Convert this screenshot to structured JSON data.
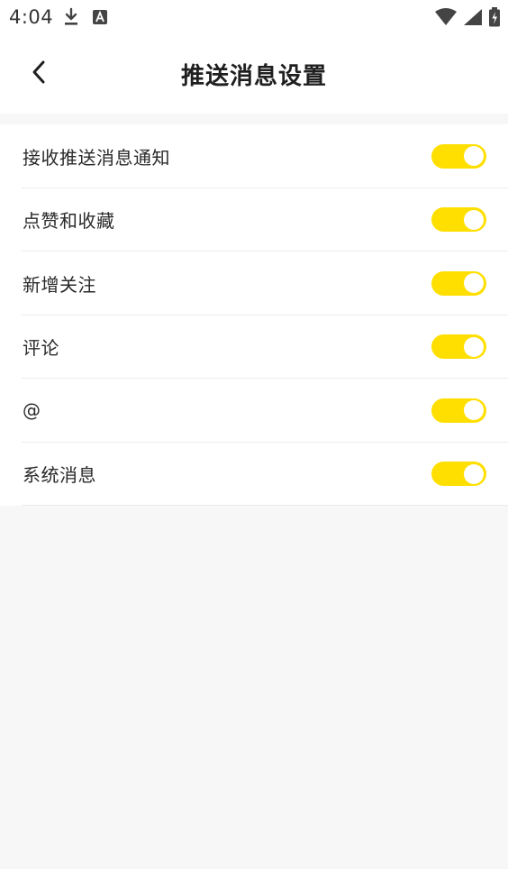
{
  "status_bar": {
    "time": "4:04",
    "icons_left": [
      "download-icon",
      "font-a-icon"
    ],
    "icons_right": [
      "wifi-icon",
      "signal-icon",
      "battery-icon"
    ]
  },
  "header": {
    "title": "推送消息设置",
    "back_icon": "chevron-left-icon"
  },
  "settings": {
    "items": [
      {
        "label": "接收推送消息通知",
        "enabled": true
      },
      {
        "label": "点赞和收藏",
        "enabled": true
      },
      {
        "label": "新增关注",
        "enabled": true
      },
      {
        "label": "评论",
        "enabled": true
      },
      {
        "label": "@",
        "enabled": true
      },
      {
        "label": "系统消息",
        "enabled": true
      }
    ]
  },
  "colors": {
    "toggle_on": "#ffdf00",
    "background": "#f7f7f7",
    "surface": "#ffffff"
  }
}
